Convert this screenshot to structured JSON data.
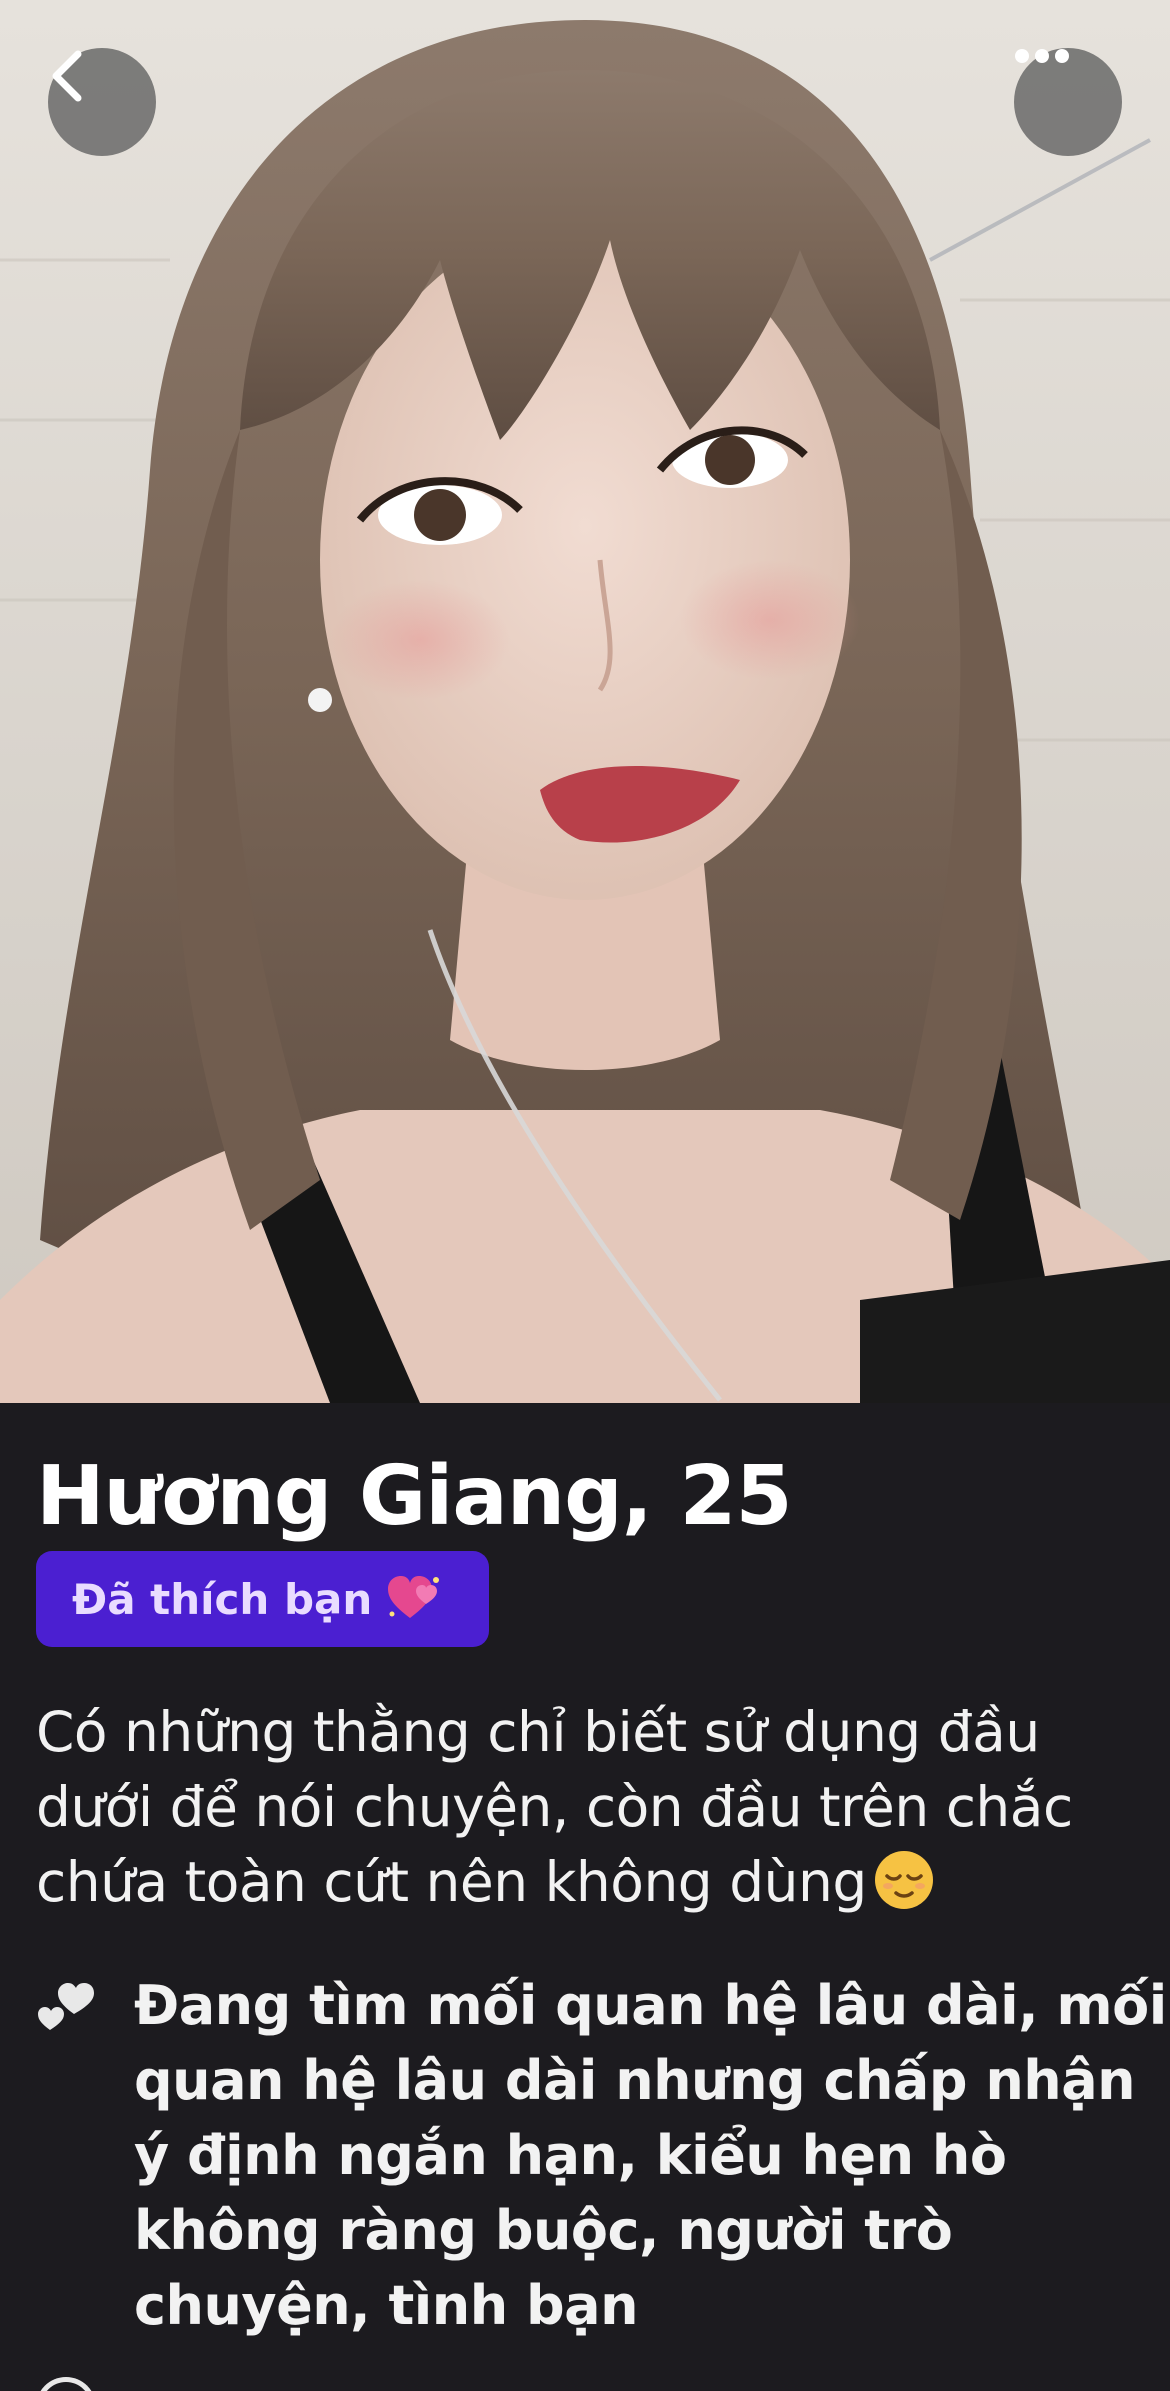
{
  "profile": {
    "name_age": "Hương Giang, 25",
    "liked_badge": "Đã thích bạn",
    "bio": "Có những thằng chỉ biết sử dụng đầu dưới để nói chuyện, còn đầu trên chắc chứa toàn cứt nên không dùng",
    "relationship_goal": "Đang tìm mối quan hệ lâu dài, mối quan hệ lâu dài nhưng chấp nhận ý định ngắn hạn, kiểu hẹn hò không ràng buộc, người trò chuyện, tình bạn"
  },
  "icons": {
    "back": "chevron-left-icon",
    "more": "ellipsis-icon",
    "badge_emoji": "sparkling-two-hearts-emoji",
    "bio_emoji": "relieved-face-emoji",
    "goal": "two-hearts-icon"
  },
  "colors": {
    "background": "#1c1b1f",
    "badge_background": "#4b1fd1",
    "badge_text": "#e9dcff",
    "text": "#f2f2f2"
  }
}
